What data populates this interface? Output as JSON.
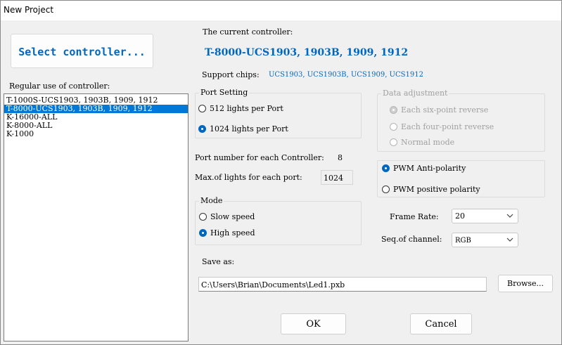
{
  "window": {
    "title": "New Project"
  },
  "select_controller_button": "Select controller...",
  "current_controller": {
    "label": "The current controller:",
    "name": "T-8000-UCS1903, 1903B, 1909, 1912",
    "support_chips_label": "Support chips:",
    "support_chips": "UCS1903, UCS1903B, UCS1909, UCS1912"
  },
  "regular_use": {
    "label": "Regular use of controller:",
    "items": [
      "T-1000S-UCS1903, 1903B, 1909, 1912",
      "T-8000-UCS1903, 1903B, 1909, 1912",
      "K-16000-ALL",
      "K-8000-ALL",
      "K-1000"
    ],
    "selected_index": 1
  },
  "port_setting": {
    "label": "Port Setting",
    "options": [
      "512 lights per Port",
      "1024 lights per Port"
    ],
    "selected_index": 1
  },
  "data_adjustment": {
    "label": "Data adjustment",
    "options": [
      "Each six-point reverse",
      "Each four-point reverse",
      "Normal mode"
    ],
    "selected_index": 0,
    "enabled": false
  },
  "port_number": {
    "label": "Port number for each Controller:",
    "value": "8"
  },
  "max_lights": {
    "label": "Max.of lights for each port:",
    "value": "1024"
  },
  "polarity": {
    "options": [
      "PWM Anti-polarity",
      "PWM positive polarity"
    ],
    "selected_index": 0
  },
  "mode": {
    "label": "Mode",
    "options": [
      "Slow speed",
      "High speed"
    ],
    "selected_index": 1
  },
  "frame_rate": {
    "label": "Frame Rate:",
    "value": "20"
  },
  "seq_channel": {
    "label": "Seq.of channel:",
    "value": "RGB"
  },
  "save_as": {
    "label": "Save as:",
    "path": "C:\\Users\\Brian\\Documents\\Led1.pxb",
    "browse_label": "Browse..."
  },
  "ok_label": "OK",
  "cancel_label": "Cancel",
  "colors": {
    "accent": "#0067c0",
    "selection": "#0078d7"
  }
}
